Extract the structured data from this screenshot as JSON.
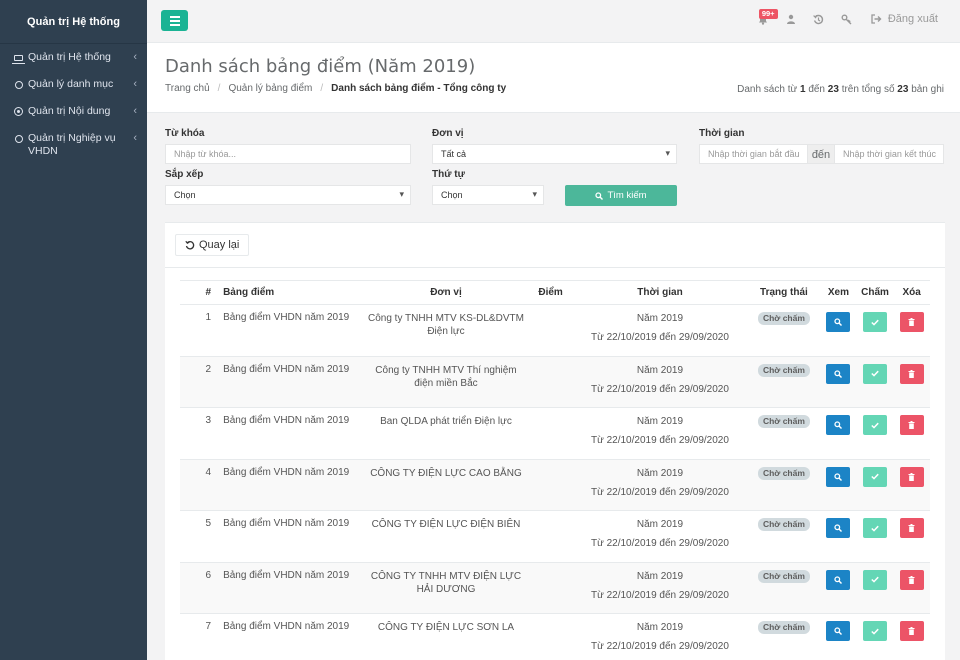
{
  "sidebar": {
    "brand": "Quản trị Hệ thống",
    "items": [
      {
        "label": "Quản trị Hệ thống",
        "icon": "laptop-icon"
      },
      {
        "label": "Quản lý danh mục",
        "icon": "circle-icon"
      },
      {
        "label": "Quản trị Nội dung",
        "icon": "dot-circle-icon"
      },
      {
        "label": "Quản trị Nghiệp vụ VHDN",
        "icon": "circle-icon"
      }
    ],
    "caret": "‹"
  },
  "topbar": {
    "badge": "99+",
    "logout": "Đăng xuất"
  },
  "heading": {
    "title": "Danh sách bảng điểm (Năm 2019)",
    "breadcrumb": [
      "Trang chủ",
      "Quản lý bảng điểm",
      "Danh sách bảng điểm - Tổng công ty"
    ],
    "summary_prefix": "Danh sách từ",
    "summary_from": "1",
    "summary_mid": "đến",
    "summary_to": "23",
    "summary_total_label": "trên tổng số",
    "summary_total": "23",
    "summary_suffix": "bản ghi"
  },
  "filters": {
    "keyword_label": "Từ khóa",
    "keyword_placeholder": "Nhập từ khóa...",
    "unit_label": "Đơn vị",
    "unit_value": "Tất cả",
    "time_label": "Thời gian",
    "time_start_placeholder": "Nhập thời gian bắt đầu",
    "time_sep": "đến",
    "time_end_placeholder": "Nhập thời gian kết thúc",
    "sort_label": "Sắp xếp",
    "sort_value": "Chọn",
    "order_label": "Thứ tự",
    "order_value": "Chọn",
    "search_button": "Tìm kiếm"
  },
  "content": {
    "back_button": "Quay lại"
  },
  "table": {
    "headers": {
      "idx": "#",
      "name": "Bảng điểm",
      "unit": "Đơn vị",
      "score": "Điểm",
      "time": "Thời gian",
      "status": "Trạng thái",
      "view": "Xem",
      "grade": "Chấm",
      "delete": "Xóa"
    },
    "rows": [
      {
        "idx": "1",
        "name": "Bảng điểm VHDN năm 2019",
        "unit": "Công ty TNHH MTV KS-DL&DVTM Điện lực",
        "score": "",
        "year": "Năm 2019",
        "range": "Từ 22/10/2019 đến 29/09/2020",
        "status": "Chờ chấm"
      },
      {
        "idx": "2",
        "name": "Bảng điểm VHDN năm 2019",
        "unit": "Công ty TNHH MTV Thí nghiệm điện miền Bắc",
        "score": "",
        "year": "Năm 2019",
        "range": "Từ 22/10/2019 đến 29/09/2020",
        "status": "Chờ chấm"
      },
      {
        "idx": "3",
        "name": "Bảng điểm VHDN năm 2019",
        "unit": "Ban QLDA phát triển Điện lực",
        "score": "",
        "year": "Năm 2019",
        "range": "Từ 22/10/2019 đến 29/09/2020",
        "status": "Chờ chấm"
      },
      {
        "idx": "4",
        "name": "Bảng điểm VHDN năm 2019",
        "unit": "CÔNG TY ĐIỆN LỰC CAO BẰNG",
        "score": "",
        "year": "Năm 2019",
        "range": "Từ 22/10/2019 đến 29/09/2020",
        "status": "Chờ chấm"
      },
      {
        "idx": "5",
        "name": "Bảng điểm VHDN năm 2019",
        "unit": "CÔNG TY ĐIỆN LỰC ĐIỆN BIÊN",
        "score": "",
        "year": "Năm 2019",
        "range": "Từ 22/10/2019 đến 29/09/2020",
        "status": "Chờ chấm"
      },
      {
        "idx": "6",
        "name": "Bảng điểm VHDN năm 2019",
        "unit": "CÔNG TY TNHH MTV ĐIỆN LỰC HẢI DƯƠNG",
        "score": "",
        "year": "Năm 2019",
        "range": "Từ 22/10/2019 đến 29/09/2020",
        "status": "Chờ chấm"
      },
      {
        "idx": "7",
        "name": "Bảng điểm VHDN năm 2019",
        "unit": "CÔNG TY ĐIỆN LỰC SƠN LA",
        "score": "",
        "year": "Năm 2019",
        "range": "Từ 22/10/2019 đến 29/09/2020",
        "status": "Chờ chấm"
      }
    ]
  },
  "colors": {
    "sidebar": "#2f4050",
    "primary": "#1ab394",
    "view": "#1c84c6",
    "grade": "#64d6b5",
    "delete": "#ec5467",
    "badge": "#ed5565"
  }
}
